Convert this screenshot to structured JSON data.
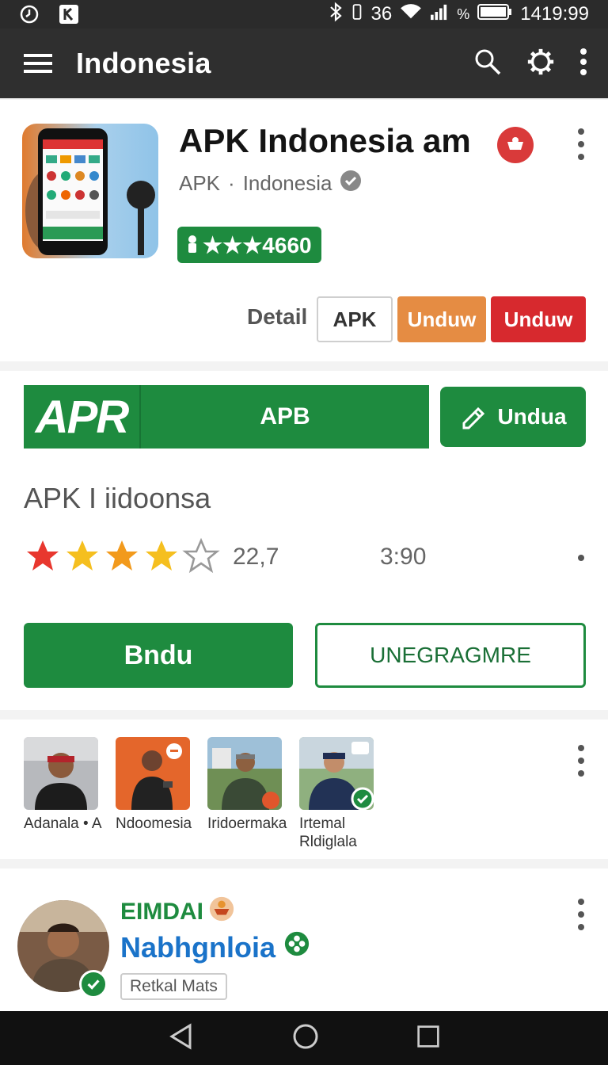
{
  "status_bar": {
    "network": "36",
    "battery_label": "%",
    "time": "1419:99"
  },
  "app_bar": {
    "title": "Indonesia"
  },
  "app_card": {
    "title": "APK Indonesia  am",
    "subtitle_left": "APK",
    "subtitle_sep": "·",
    "subtitle_right": "Indonesia",
    "rating_text": "★★★4660",
    "detail_label": "Detail",
    "apk_button": "APK",
    "unduw_orange": "Unduw",
    "unduw_red": "Unduw"
  },
  "download_card": {
    "banner_logo": "APR",
    "banner_text": "APB",
    "unduh_button": "Undua",
    "app_name": "APK I iidoonsa",
    "rating": 4,
    "meta_count": "22,7",
    "meta_size": "3:90",
    "primary_button": "Bndu",
    "outline_button": "UNEGRAGMRE"
  },
  "people": [
    {
      "label": "Adanala • A"
    },
    {
      "label": "Ndoomesia"
    },
    {
      "label": "Iridoermaka"
    },
    {
      "label": "Irtemal Rldiglala"
    }
  ],
  "profile_card": {
    "name_small": "EIMDAI",
    "name_large": "Nabhgnloia",
    "tag": "Retkal Mats"
  },
  "colors": {
    "green": "#1e8b3f",
    "red": "#d7292e",
    "orange": "#e58c43",
    "blue": "#1a73c9"
  }
}
